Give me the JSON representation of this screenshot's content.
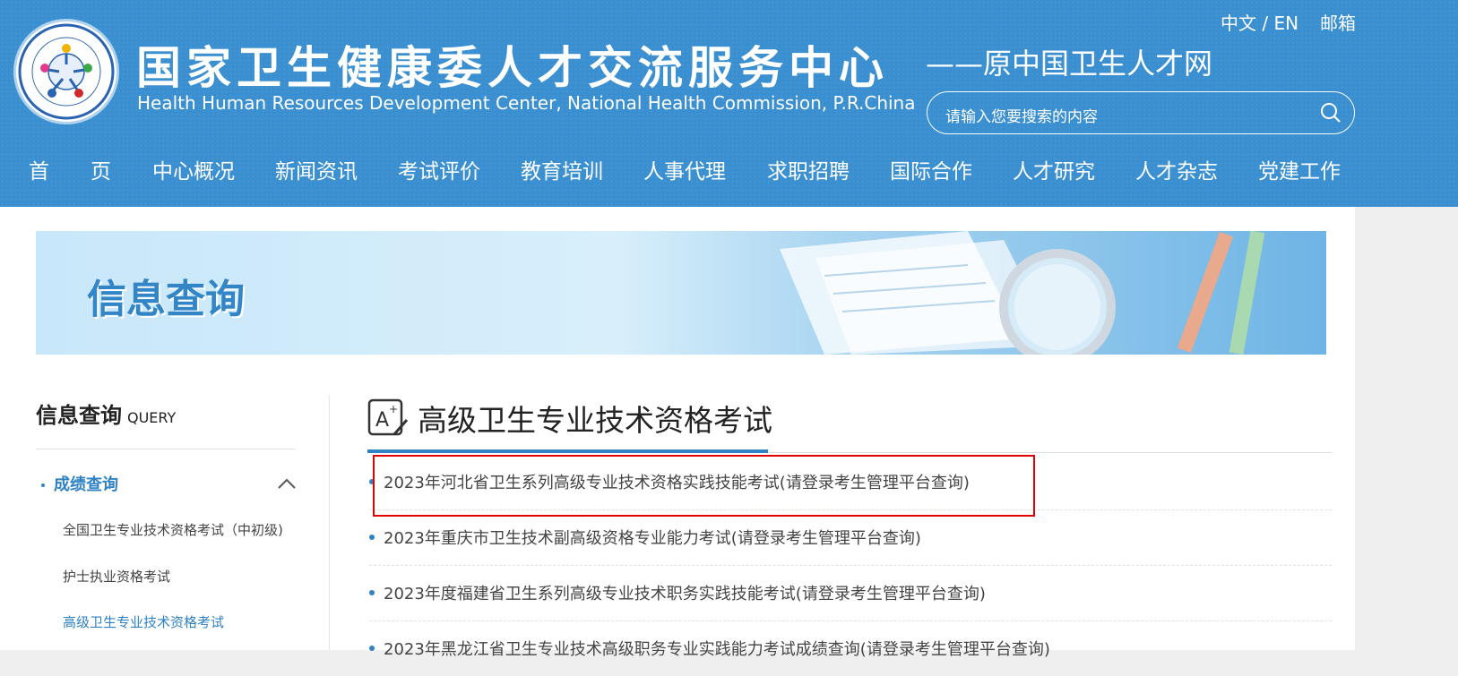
{
  "header": {
    "title_cn": "国家卫生健康委人才交流服务中心",
    "title_en": "Health Human Resources Development Center, National Health Commission, P.R.China",
    "subtitle": "——原中国卫生人才网",
    "lang_switch": "中文 / EN",
    "mail": "邮箱",
    "search_placeholder": "请输入您要搜索的内容",
    "logo_icon": "logo-seal-icon",
    "search_icon": "search-icon"
  },
  "nav": [
    {
      "label": "首　　页"
    },
    {
      "label": "中心概况"
    },
    {
      "label": "新闻资讯"
    },
    {
      "label": "考试评价"
    },
    {
      "label": "教育培训"
    },
    {
      "label": "人事代理"
    },
    {
      "label": "求职招聘"
    },
    {
      "label": "国际合作"
    },
    {
      "label": "人才研究"
    },
    {
      "label": "人才杂志"
    },
    {
      "label": "党建工作"
    }
  ],
  "banner": {
    "title": "信息查询"
  },
  "sidebar": {
    "heading": "信息查询",
    "heading_en": "QUERY",
    "category": "成绩查询",
    "items": [
      {
        "label": "全国卫生专业技术资格考试（中初级)"
      },
      {
        "label": "护士执业资格考试"
      },
      {
        "label": "高级卫生专业技术资格考试",
        "active": true
      }
    ]
  },
  "content": {
    "title": "高级卫生专业技术资格考试",
    "items": [
      {
        "text": "2023年河北省卫生系列高级专业技术资格实践技能考试(请登录考生管理平台查询)",
        "highlighted": true
      },
      {
        "text": "2023年重庆市卫生技术副高级资格专业能力考试(请登录考生管理平台查询)"
      },
      {
        "text": "2023年度福建省卫生系列高级专业技术职务实践技能考试(请登录考生管理平台查询)"
      },
      {
        "text": "2023年黑龙江省卫生专业技术高级职务专业实践能力考试成绩查询(请登录考生管理平台查询)"
      }
    ]
  },
  "colors": {
    "header_bg": "#3a8fd0",
    "accent": "#2f82c4",
    "highlight_box": "#e00000"
  }
}
